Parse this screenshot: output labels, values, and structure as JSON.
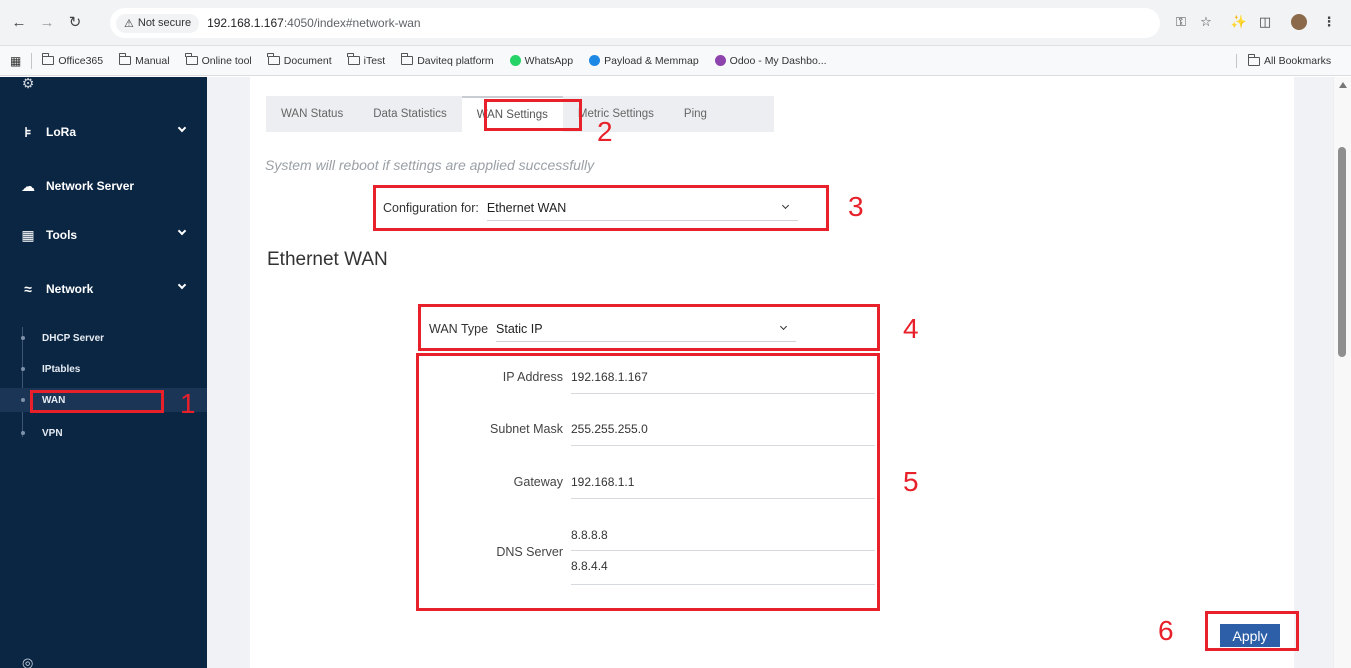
{
  "browser": {
    "secure_label": "Not secure",
    "url_host": "192.168.1.167",
    "url_path": ":4050/index#network-wan",
    "bookmarks": [
      {
        "label": "Office365",
        "icon": "folder-icon"
      },
      {
        "label": "Manual",
        "icon": "folder-icon"
      },
      {
        "label": "Online tool",
        "icon": "folder-icon"
      },
      {
        "label": "Document",
        "icon": "folder-icon"
      },
      {
        "label": "iTest",
        "icon": "folder-icon"
      },
      {
        "label": "Daviteq platform",
        "icon": "folder-icon"
      },
      {
        "label": "WhatsApp",
        "icon": "whatsapp-icon",
        "color": "#25d366"
      },
      {
        "label": "Payload & Memmap",
        "icon": "cloud-icon",
        "color": "#1e88e5"
      },
      {
        "label": "Odoo - My Dashbo...",
        "icon": "odoo-icon",
        "color": "#8e44ad"
      }
    ],
    "all_bookmarks": "All Bookmarks"
  },
  "sidebar": {
    "items": [
      {
        "label": "LoRa",
        "icon": "lora-icon"
      },
      {
        "label": "Network Server",
        "icon": "cloud-server-icon"
      },
      {
        "label": "Tools",
        "icon": "tools-grid-icon"
      },
      {
        "label": "Network",
        "icon": "wifi-icon"
      }
    ],
    "network_sub": [
      "DHCP Server",
      "IPtables",
      "WAN",
      "VPN"
    ],
    "active_sub": "WAN"
  },
  "tabs": [
    "WAN Status",
    "Data Statistics",
    "WAN Settings",
    "Metric Settings",
    "Ping"
  ],
  "active_tab": "WAN Settings",
  "reboot_note": "System will reboot if settings are applied successfully",
  "config": {
    "label": "Configuration for:",
    "value": "Ethernet WAN"
  },
  "section_title": "Ethernet WAN",
  "wan_type": {
    "label": "WAN Type",
    "value": "Static IP"
  },
  "fields": {
    "ip_label": "IP Address",
    "ip_value": "192.168.1.167",
    "mask_label": "Subnet Mask",
    "mask_value": "255.255.255.0",
    "gateway_label": "Gateway",
    "gateway_value": "192.168.1.1",
    "dns_label": "DNS Server",
    "dns1": "8.8.8.8",
    "dns2": "8.8.4.4"
  },
  "apply_label": "Apply",
  "annotations": [
    "1",
    "2",
    "3",
    "4",
    "5",
    "6"
  ],
  "colors": {
    "sidebar": "#0b2643",
    "annotation": "#e8202a",
    "apply": "#2d5fa8"
  }
}
